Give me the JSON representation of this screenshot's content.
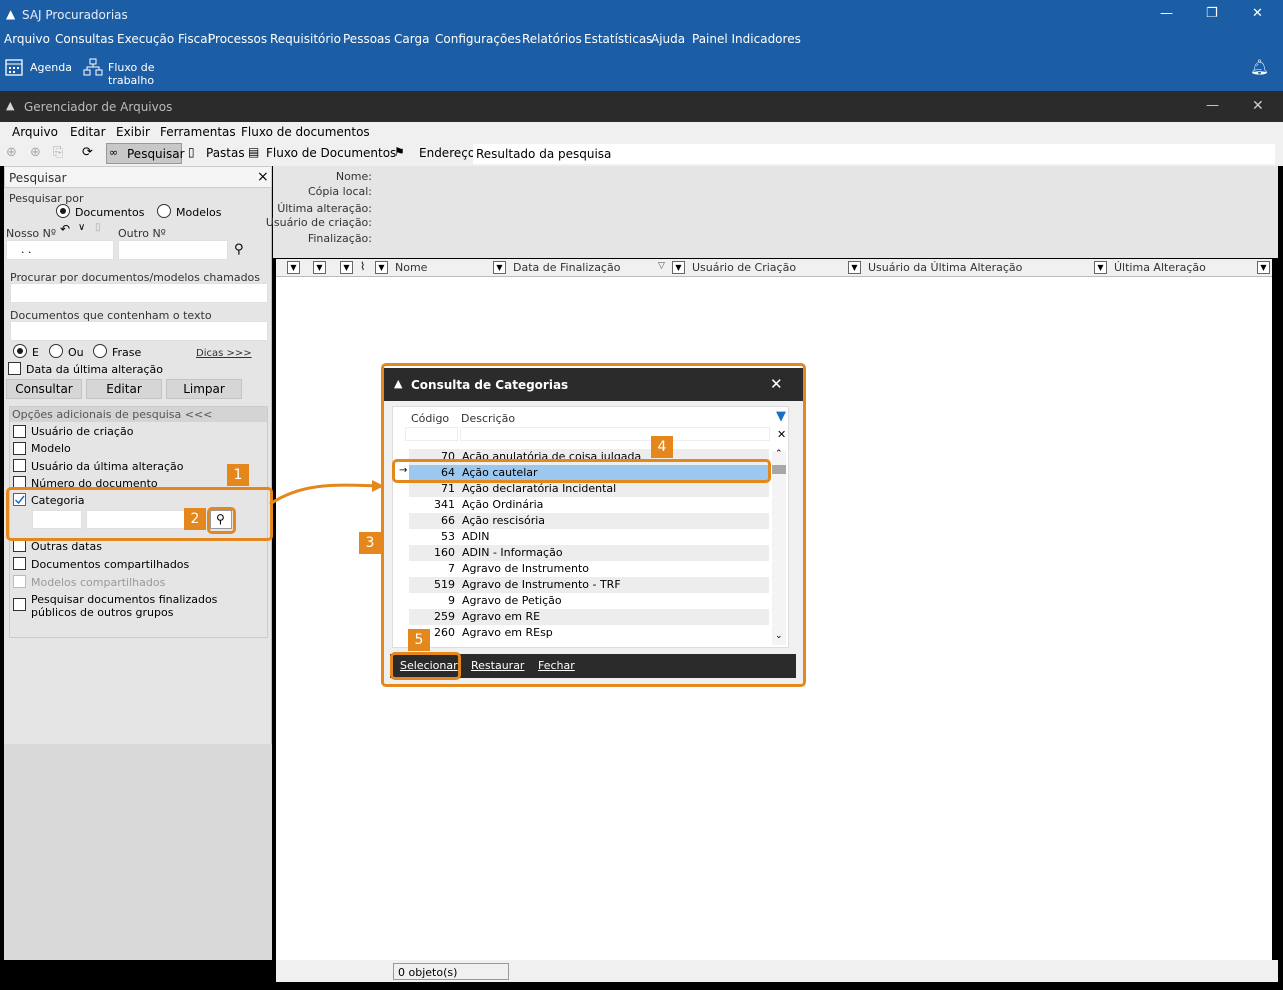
{
  "app": {
    "title": "SAJ Procuradorias",
    "menu": [
      "Arquivo",
      "Consultas",
      "Execução Fiscal",
      "Processos",
      "Requisitório",
      "Pessoas",
      "Carga",
      "Configurações",
      "Relatórios",
      "Estatísticas",
      "Ajuda",
      "Painel Indicadores"
    ],
    "toolbar": {
      "agenda": "Agenda",
      "fluxo": "Fluxo de trabalho"
    }
  },
  "window": {
    "title": "Gerenciador de Arquivos",
    "menu": [
      "Arquivo",
      "Editar",
      "Exibir",
      "Ferramentas",
      "Fluxo de documentos"
    ],
    "toolbar": {
      "pesquisar": "Pesquisar",
      "pastas": "Pastas",
      "fluxo_documentos": "Fluxo de Documentos",
      "endereco_label": "Endereço",
      "endereco_value": "Resultado da pesquisa"
    }
  },
  "search_panel": {
    "title": "Pesquisar",
    "close": "×",
    "pesquisar_por": "Pesquisar por",
    "opt_documentos": "Documentos",
    "opt_modelos": "Modelos",
    "nosso_no": "Nosso Nº",
    "nosso_no_value": ". .",
    "outro_no": "Outro Nº",
    "procurar_label": "Procurar por documentos/modelos chamados",
    "texto_label": "Documentos que contenham o texto",
    "op_e": "E",
    "op_ou": "Ou",
    "op_frase": "Frase",
    "dicas": "Dicas >>>",
    "data_ultima": "Data da última alteração",
    "btn_consultar": "Consultar",
    "btn_editar": "Editar",
    "btn_limpar": "Limpar",
    "opcoes_header": "Opções adicionais de pesquisa <<<",
    "options": [
      {
        "label": "Usuário de criação",
        "checked": false
      },
      {
        "label": "Modelo",
        "checked": false
      },
      {
        "label": "Usuário da última alteração",
        "checked": false
      },
      {
        "label": "Número do documento",
        "checked": false
      },
      {
        "label": "Categoria",
        "checked": true
      }
    ],
    "options2": [
      {
        "label": "Outras datas"
      },
      {
        "label": "Documentos compartilhados"
      },
      {
        "label": "Modelos compartilhados"
      }
    ],
    "publicos": "Pesquisar documentos finalizados públicos de outros grupos"
  },
  "details": {
    "nome": "Nome:",
    "copia": "Cópia local:",
    "ultima": "Última alteração:",
    "usuario": "Usuário de criação:",
    "finalizacao": "Finalização:"
  },
  "grid": {
    "columns": [
      "Nome",
      "Data de Finalização",
      "Usuário de Criação",
      "Usuário da Última Alteração",
      "Última Alteração"
    ]
  },
  "status": {
    "count": "0 objeto(s)"
  },
  "dialog": {
    "title": "Consulta de Categorias",
    "col_codigo": "Código",
    "col_descricao": "Descrição",
    "rows": [
      {
        "code": "70",
        "desc": "Ação anulatória de coisa julgada"
      },
      {
        "code": "64",
        "desc": "Ação cautelar"
      },
      {
        "code": "71",
        "desc": "Ação declaratória Incidental"
      },
      {
        "code": "341",
        "desc": "Ação Ordinária"
      },
      {
        "code": "66",
        "desc": "Ação rescisória"
      },
      {
        "code": "53",
        "desc": "ADIN"
      },
      {
        "code": "160",
        "desc": "ADIN - Informação"
      },
      {
        "code": "7",
        "desc": "Agravo de Instrumento"
      },
      {
        "code": "519",
        "desc": "Agravo de Instrumento - TRF"
      },
      {
        "code": "9",
        "desc": "Agravo de Petição"
      },
      {
        "code": "259",
        "desc": "Agravo em RE"
      },
      {
        "code": "260",
        "desc": "Agravo em REsp"
      }
    ],
    "btn_selecionar": "Selecionar",
    "btn_restaurar": "Restaurar",
    "btn_fechar": "Fechar"
  },
  "annotations": [
    "1",
    "2",
    "3",
    "4",
    "5"
  ],
  "colors": {
    "accent": "#1c5ea6",
    "annotation": "#e4881e",
    "dark": "#2b2b2b"
  }
}
